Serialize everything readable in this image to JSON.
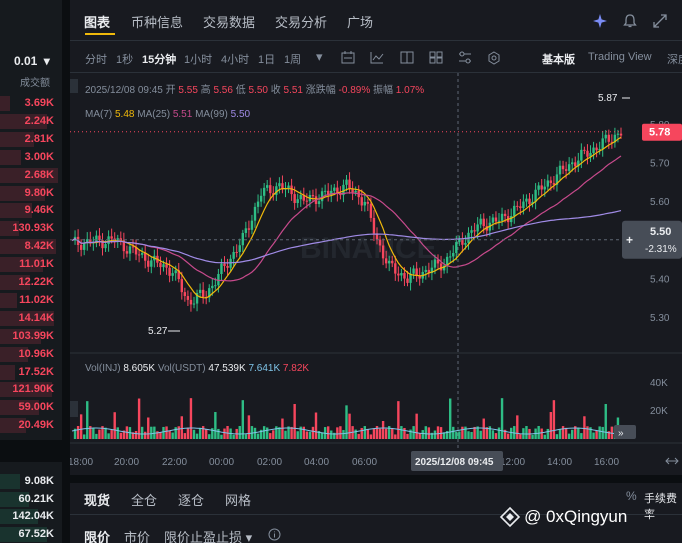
{
  "left_panel": {
    "precision": "0.01",
    "precision_icon": "chevron-down-icon",
    "column_label": "成交额",
    "upper_rows": [
      "3.69K",
      "2.24K",
      "2.81K",
      "3.00K",
      "2.68K",
      "9.80K",
      "9.46K",
      "130.93K",
      "8.42K",
      "11.01K",
      "12.22K",
      "11.02K",
      "14.14K",
      "103.99K",
      "10.96K",
      "17.52K",
      "121.90K",
      "59.00K",
      "20.49K"
    ],
    "lower_rows": [
      "9.08K",
      "60.21K",
      "142.04K",
      "67.52K"
    ],
    "sell_color": "#f6465d",
    "buy_color": "#2ebd85"
  },
  "header": {
    "tabs": [
      "图表",
      "币种信息",
      "交易数据",
      "交易分析",
      "广场"
    ],
    "active_tab": "图表",
    "icons": [
      "sparkle-icon",
      "bell-icon",
      "expand-icon"
    ]
  },
  "toolbar": {
    "intervals": [
      "分时",
      "1秒",
      "15分钟",
      "1小时",
      "4小时",
      "1日",
      "1周"
    ],
    "active_interval": "15分钟",
    "tool_icons": [
      "chevron-down-icon",
      "indicator-icon",
      "chart-line-icon",
      "layout-icon",
      "grid-icon",
      "sliders-icon",
      "settings-icon"
    ],
    "views": [
      "基本版",
      "Trading View",
      "深度"
    ],
    "active_view": "基本版"
  },
  "chart": {
    "ohlc": {
      "date": "2025/12/08 09:45",
      "open_label": "开",
      "open": "5.55",
      "high_label": "高",
      "high": "5.56",
      "low_label": "低",
      "low": "5.50",
      "close_label": "收",
      "close": "5.51",
      "change_label": "涨跌幅",
      "change": "-0.89%",
      "amp_label": "振幅",
      "amp": "1.07%"
    },
    "ma": {
      "ma7_label": "MA(7)",
      "ma7": "5.48",
      "ma25_label": "MA(25)",
      "ma25": "5.51",
      "ma99_label": "MA(99)",
      "ma99": "5.50"
    },
    "price_axis": [
      "5.80",
      "5.70",
      "5.60",
      "5.50",
      "5.40",
      "5.30"
    ],
    "last_price": "5.78",
    "crosshair_price": "5.50",
    "crosshair_change": "-2.31%",
    "max_label": "5.87",
    "min_label": "5.27",
    "watermark": "BINANCE",
    "volume": {
      "base_label": "Vol(INJ)",
      "base_value": "8.605K",
      "quote_label": "Vol(USDT)",
      "quote_value": "47.539K",
      "ma1": "7.641K",
      "ma2": "7.82K",
      "axis": [
        "40K",
        "20K"
      ]
    },
    "time_axis": [
      "18:00",
      "20:00",
      "22:00",
      "00:00",
      "02:00",
      "04:00",
      "06:00",
      "12:00",
      "14:00",
      "16:00"
    ],
    "crosshair_time": "2025/12/08 09:45",
    "colors": {
      "up": "#2ebd85",
      "down": "#f6465d",
      "ma7": "#f0b90b",
      "ma25": "#c74a8c",
      "ma99": "#a08be6"
    }
  },
  "bottom": {
    "tabs": [
      "现货",
      "全仓",
      "逐仓",
      "网格"
    ],
    "active_tab": "现货",
    "fee_label": "手续费率",
    "order_types": [
      "限价",
      "市价",
      "限价止盈止损"
    ],
    "active_order_type": "限价"
  },
  "watermark_overlay": "@ 0xQingyun"
}
